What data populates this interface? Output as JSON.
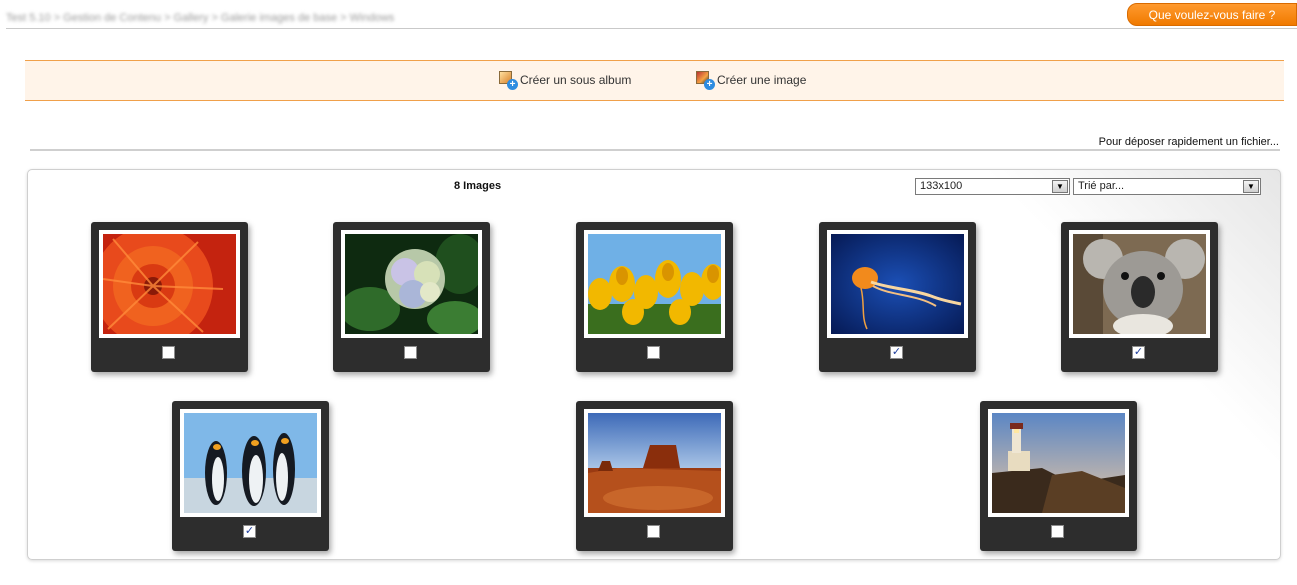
{
  "breadcrumb": "Test 5.10 > Gestion de Contenu > Gallery > Galerie images de base > Windows",
  "help_button": "Que voulez-vous faire ?",
  "actions": {
    "create_subalbum": "Créer un sous album",
    "create_image": "Créer une image"
  },
  "upload_link": "Pour déposer rapidement un fichier...",
  "gallery": {
    "count_label": "8 Images",
    "size_select": "133x100",
    "sort_select": "Trié par...",
    "images": [
      {
        "name": "chrysanthemum",
        "checked": false
      },
      {
        "name": "hydrangeas",
        "checked": false
      },
      {
        "name": "tulips",
        "checked": false
      },
      {
        "name": "jellyfish",
        "checked": true
      },
      {
        "name": "koala",
        "checked": true
      },
      {
        "name": "penguins",
        "checked": true
      },
      {
        "name": "desert",
        "checked": false
      },
      {
        "name": "lighthouse",
        "checked": false
      }
    ]
  }
}
